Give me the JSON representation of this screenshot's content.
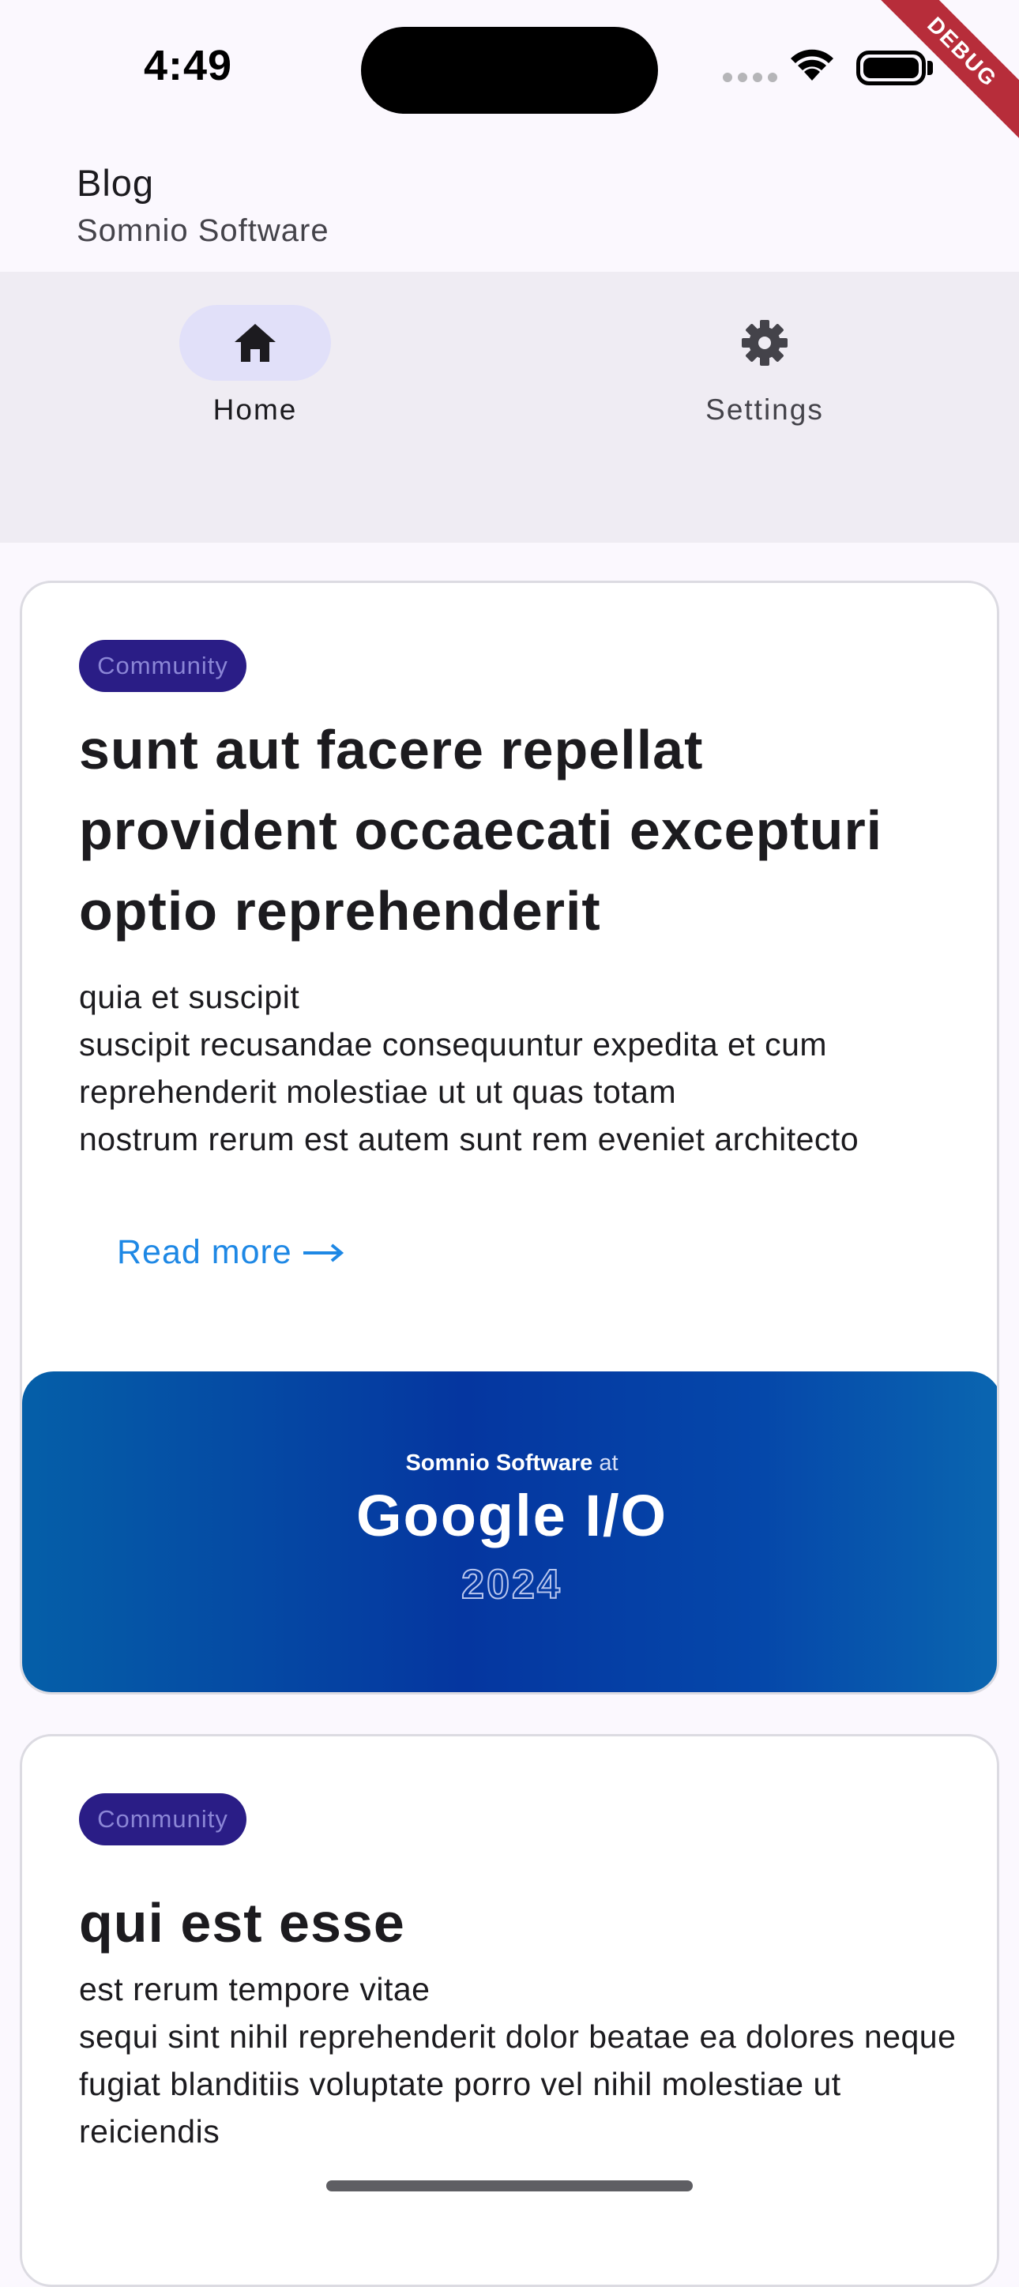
{
  "status_bar": {
    "time": "4:49",
    "debug_label": "DEBUG"
  },
  "app_bar": {
    "title": "Blog",
    "subtitle": "Somnio Software"
  },
  "nav": {
    "items": [
      {
        "label": "Home",
        "icon": "home-icon",
        "selected": true
      },
      {
        "label": "Settings",
        "icon": "gear-icon",
        "selected": false
      }
    ]
  },
  "posts": [
    {
      "tag": "Community",
      "title": "sunt aut facere repellat provident occaecati excepturi optio reprehenderit",
      "body": "quia et suscipit\nsuscipit recusandae consequuntur expedita et cum reprehenderit molestiae ut ut quas totam\nnostrum rerum est autem sunt rem eveniet architecto",
      "read_more": "Read more",
      "banner": {
        "company": "Somnio Software",
        "at": "at",
        "event": "Google I/O",
        "year": "2024"
      }
    },
    {
      "tag": "Community",
      "title": "qui est esse",
      "body": "est rerum tempore vitae\nsequi sint nihil reprehenderit dolor beatae ea dolores neque\nfugiat blanditiis voluptate porro vel nihil molestiae ut reiciendis"
    }
  ],
  "colors": {
    "accent": "#1e88e5",
    "tag_background": "#2a1d86",
    "nav_indicator": "#e1e0f9"
  }
}
